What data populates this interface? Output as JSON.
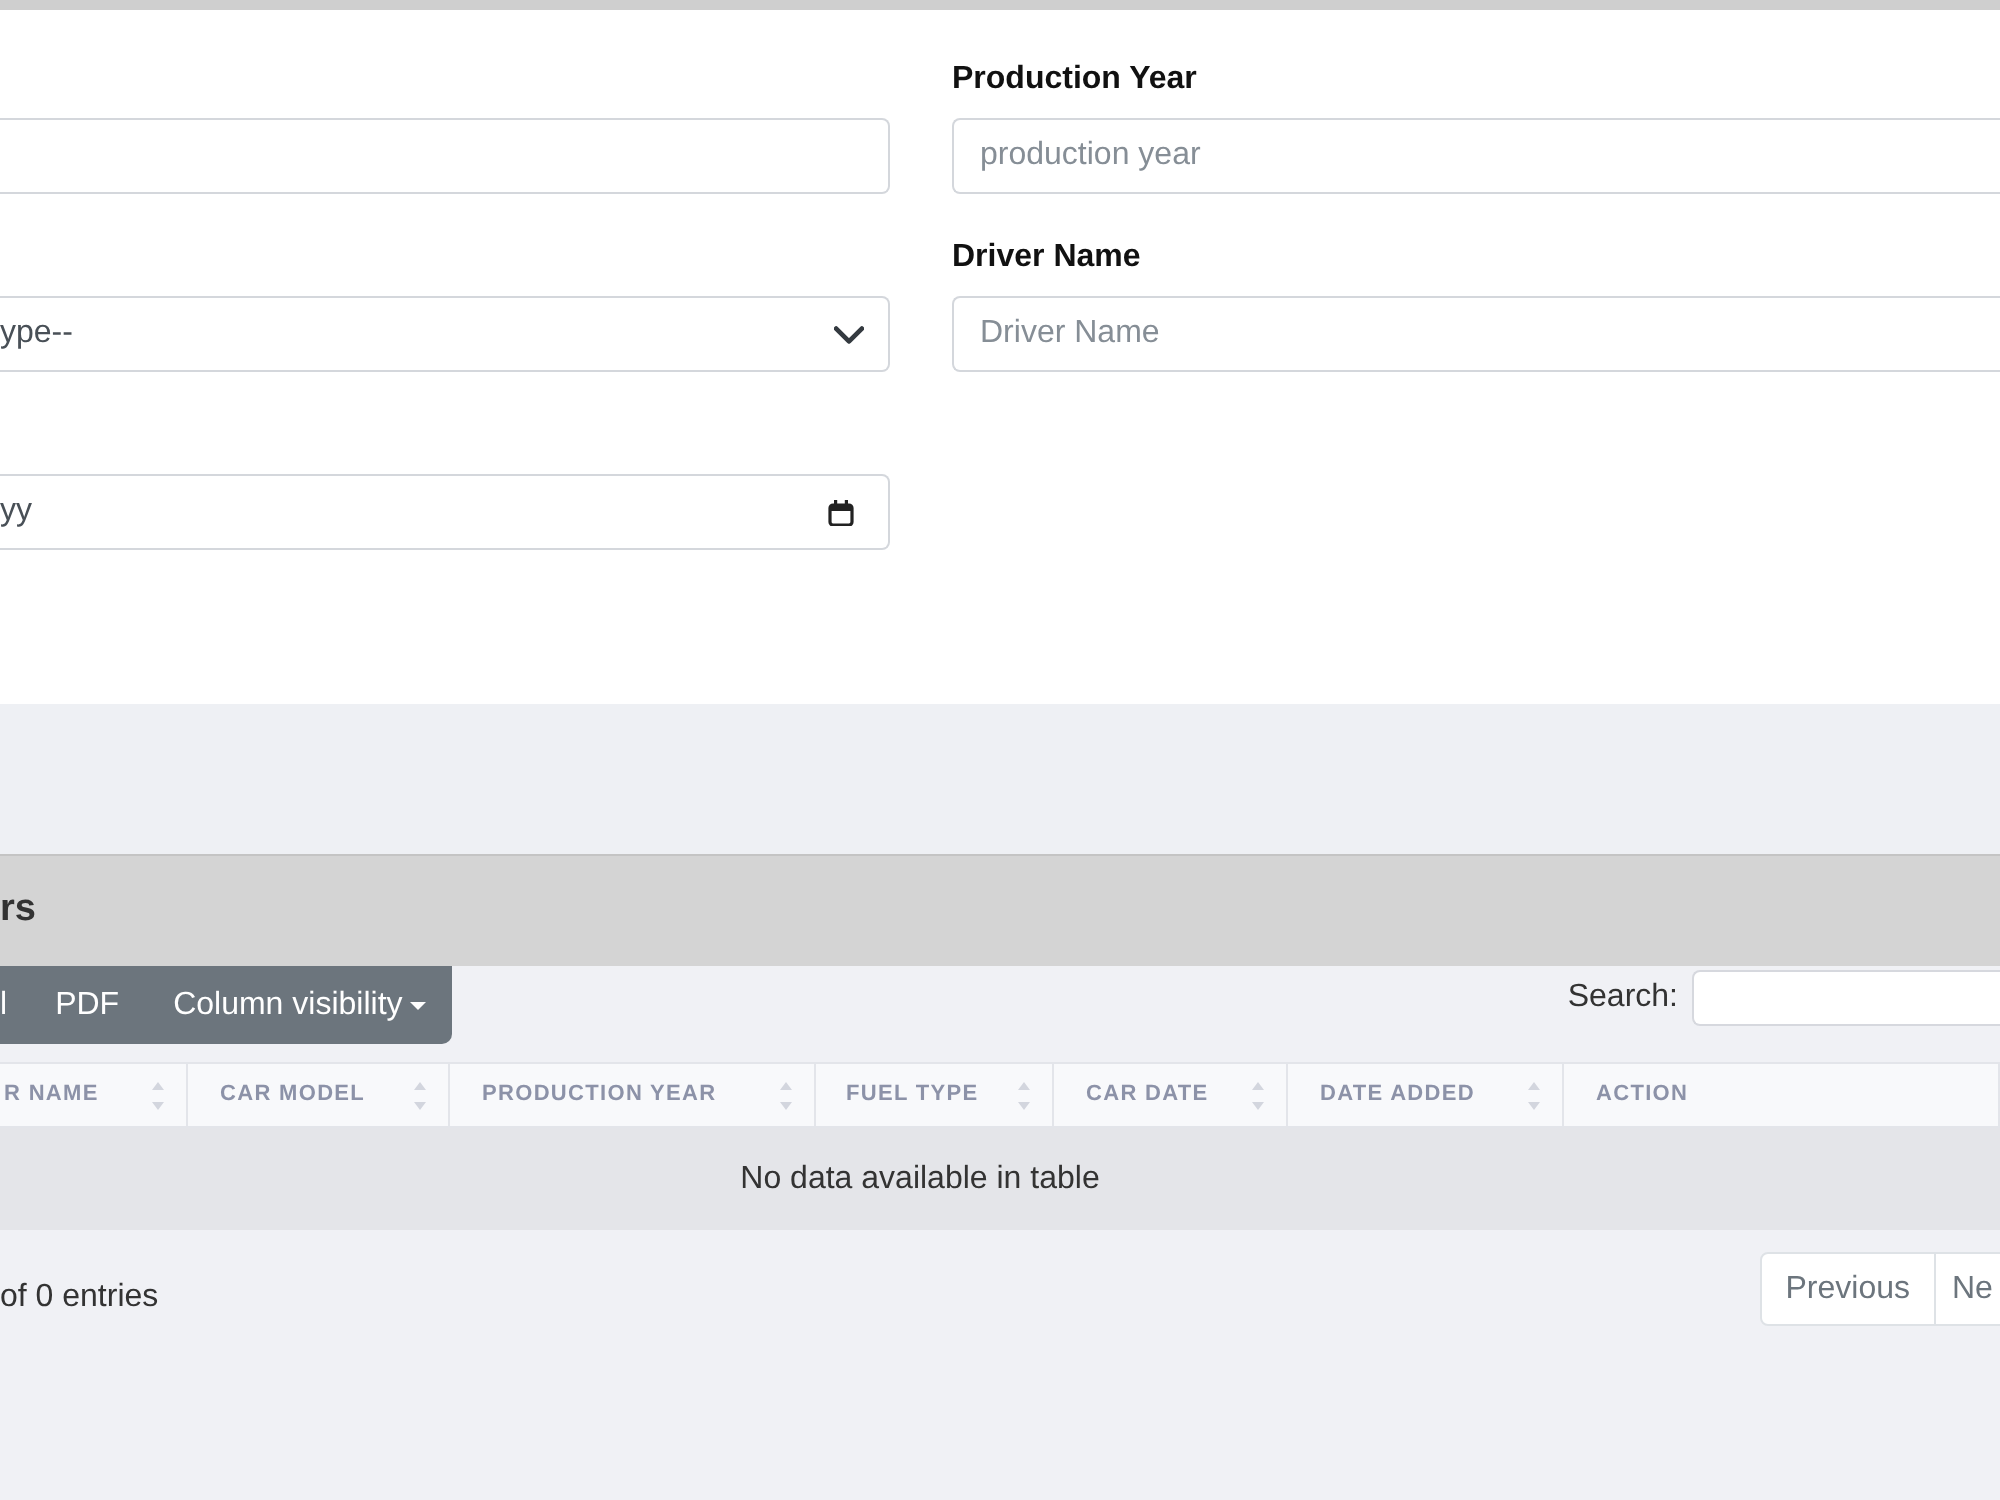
{
  "form": {
    "left_fields": [
      {
        "kind": "text"
      },
      {
        "kind": "select",
        "value": "ype--"
      },
      {
        "kind": "date",
        "value": "yy"
      }
    ],
    "right_fields": [
      {
        "kind": "text",
        "label": "Production Year",
        "placeholder": "production year"
      },
      {
        "kind": "text",
        "label": "Driver Name",
        "placeholder": "Driver Name"
      }
    ]
  },
  "section": {
    "title": "rs",
    "toolbar": [
      {
        "kind": "button",
        "label": "l"
      },
      {
        "kind": "button",
        "label": "PDF"
      },
      {
        "kind": "dropdown",
        "label": "Column visibility"
      }
    ],
    "search": {
      "label": "Search:"
    },
    "table": {
      "columns": [
        {
          "label": "R NAME",
          "sortable": true
        },
        {
          "label": "CAR MODEL",
          "sortable": true
        },
        {
          "label": "PRODUCTION YEAR",
          "sortable": true
        },
        {
          "label": "FUEL TYPE",
          "sortable": true
        },
        {
          "label": "CAR DATE",
          "sortable": true
        },
        {
          "label": "DATE ADDED",
          "sortable": true
        },
        {
          "label": "ACTION",
          "sortable": false
        }
      ],
      "empty_message": "No data available in table"
    },
    "info": "of 0 entries",
    "pagination": [
      {
        "label": "Previous"
      },
      {
        "label": "Ne"
      }
    ]
  }
}
